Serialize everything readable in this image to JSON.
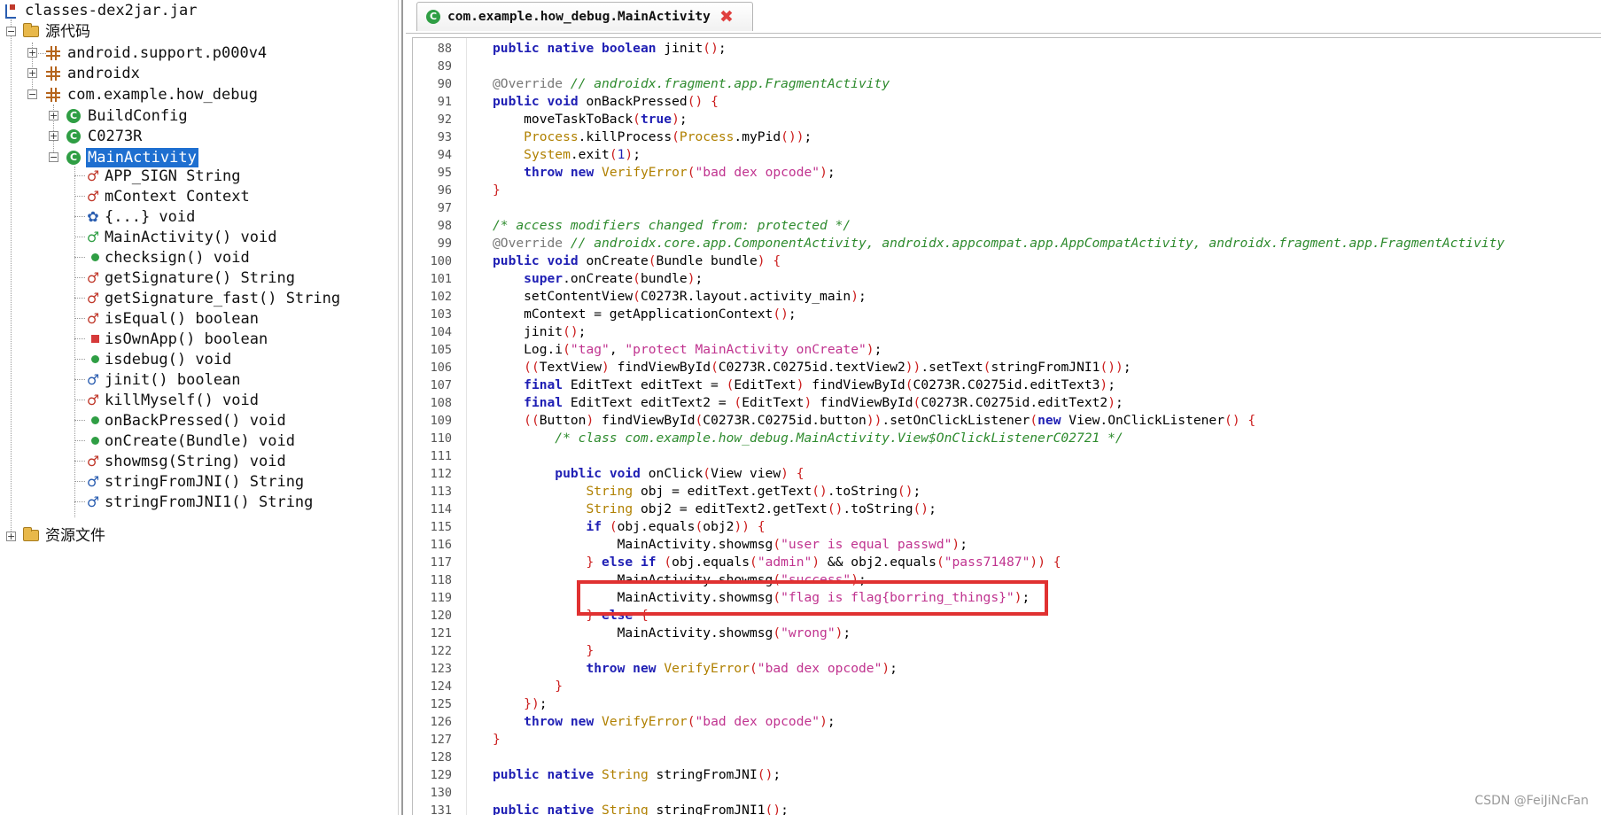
{
  "tree": {
    "root_label": "classes-dex2jar.jar",
    "source_folder_label": "源代码",
    "resources_folder_label": "资源文件",
    "packages": [
      "android.support.p000v4",
      "androidx",
      "com.example.how_debug"
    ],
    "classes": [
      "BuildConfig",
      "C0273R",
      "MainActivity"
    ],
    "selected_class": "MainActivity",
    "members": [
      {
        "label": "APP_SIGN String",
        "icon": "field-icon"
      },
      {
        "label": "mContext Context",
        "icon": "field-icon"
      },
      {
        "label": "{...} void",
        "icon": "static-init-icon"
      },
      {
        "label": "MainActivity() void",
        "icon": "constructor-icon"
      },
      {
        "label": "checksign() void",
        "icon": "public-method-icon"
      },
      {
        "label": "getSignature() String",
        "icon": "method-icon"
      },
      {
        "label": "getSignature_fast() String",
        "icon": "method-icon"
      },
      {
        "label": "isEqual() boolean",
        "icon": "method-icon"
      },
      {
        "label": "isOwnApp() boolean",
        "icon": "private-method-icon"
      },
      {
        "label": "isdebug() void",
        "icon": "public-method-icon"
      },
      {
        "label": "jinit() boolean",
        "icon": "native-method-icon"
      },
      {
        "label": "killMyself() void",
        "icon": "method-icon"
      },
      {
        "label": "onBackPressed() void",
        "icon": "public-method-icon"
      },
      {
        "label": "onCreate(Bundle) void",
        "icon": "public-method-icon"
      },
      {
        "label": "showmsg(String) void",
        "icon": "method-icon"
      },
      {
        "label": "stringFromJNI() String",
        "icon": "native-method-icon"
      },
      {
        "label": "stringFromJNI1() String",
        "icon": "native-method-icon"
      }
    ]
  },
  "editor": {
    "tab_title": "com.example.how_debug.MainActivity",
    "class_icon_letter": "C",
    "close_glyph": "✖",
    "lines": [
      {
        "n": "88",
        "code": "public native boolean jinit();"
      },
      {
        "n": "89",
        "code": ""
      },
      {
        "n": "90",
        "code": "@Override // androidx.fragment.app.FragmentActivity"
      },
      {
        "n": "91",
        "code": "public void onBackPressed() {"
      },
      {
        "n": "92",
        "code": "    moveTaskToBack(true);"
      },
      {
        "n": "93",
        "code": "    Process.killProcess(Process.myPid());"
      },
      {
        "n": "94",
        "code": "    System.exit(1);"
      },
      {
        "n": "95",
        "code": "    throw new VerifyError(\"bad dex opcode\");"
      },
      {
        "n": "96",
        "code": "}"
      },
      {
        "n": "97",
        "code": ""
      },
      {
        "n": "98",
        "code": "/* access modifiers changed from: protected */"
      },
      {
        "n": "99",
        "code": "@Override // androidx.core.app.ComponentActivity, androidx.appcompat.app.AppCompatActivity, androidx.fragment.app.FragmentActivity"
      },
      {
        "n": "100",
        "code": "public void onCreate(Bundle bundle) {"
      },
      {
        "n": "101",
        "code": "    super.onCreate(bundle);"
      },
      {
        "n": "102",
        "code": "    setContentView(C0273R.layout.activity_main);"
      },
      {
        "n": "103",
        "code": "    mContext = getApplicationContext();"
      },
      {
        "n": "104",
        "code": "    jinit();"
      },
      {
        "n": "105",
        "code": "    Log.i(\"tag\", \"protect MainActivity onCreate\");"
      },
      {
        "n": "106",
        "code": "    ((TextView) findViewById(C0273R.C0275id.textView2)).setText(stringFromJNI1());"
      },
      {
        "n": "107",
        "code": "    final EditText editText = (EditText) findViewById(C0273R.C0275id.editText3);"
      },
      {
        "n": "108",
        "code": "    final EditText editText2 = (EditText) findViewById(C0273R.C0275id.editText2);"
      },
      {
        "n": "109",
        "code": "    ((Button) findViewById(C0273R.C0275id.button)).setOnClickListener(new View.OnClickListener() {"
      },
      {
        "n": "110",
        "code": "        /* class com.example.how_debug.MainActivity.View$OnClickListenerC02721 */"
      },
      {
        "n": "111",
        "code": ""
      },
      {
        "n": "112",
        "code": "        public void onClick(View view) {"
      },
      {
        "n": "113",
        "code": "            String obj = editText.getText().toString();"
      },
      {
        "n": "114",
        "code": "            String obj2 = editText2.getText().toString();"
      },
      {
        "n": "115",
        "code": "            if (obj.equals(obj2)) {"
      },
      {
        "n": "116",
        "code": "                MainActivity.showmsg(\"user is equal passwd\");"
      },
      {
        "n": "117",
        "code": "            } else if (obj.equals(\"admin\") && obj2.equals(\"pass71487\")) {"
      },
      {
        "n": "118",
        "code": "                MainActivity.showmsg(\"success\");"
      },
      {
        "n": "119",
        "code": "                MainActivity.showmsg(\"flag is flag{borring_things}\");"
      },
      {
        "n": "120",
        "code": "            } else {"
      },
      {
        "n": "121",
        "code": "                MainActivity.showmsg(\"wrong\");"
      },
      {
        "n": "122",
        "code": "            }"
      },
      {
        "n": "123",
        "code": "            throw new VerifyError(\"bad dex opcode\");"
      },
      {
        "n": "124",
        "code": "        }"
      },
      {
        "n": "125",
        "code": "    });"
      },
      {
        "n": "126",
        "code": "    throw new VerifyError(\"bad dex opcode\");"
      },
      {
        "n": "127",
        "code": "}"
      },
      {
        "n": "128",
        "code": ""
      },
      {
        "n": "129",
        "code": "public native String stringFromJNI();"
      },
      {
        "n": "130",
        "code": ""
      },
      {
        "n": "131",
        "code": "public native String stringFromJNI1();"
      }
    ]
  },
  "annotation": {
    "highlight_line": "119",
    "color": "#e03131"
  },
  "watermark": "CSDN @FeiJiNcFan",
  "colors": {
    "keyword": "#1f1fb4",
    "string": "#c0338f",
    "comment": "#2e8b2e",
    "type": "#b08000",
    "selection": "#1e6fd0"
  }
}
